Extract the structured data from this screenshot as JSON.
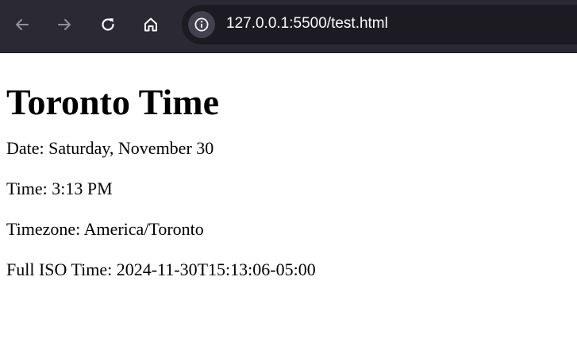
{
  "browser": {
    "url": "127.0.0.1:5500/test.html",
    "toolbar_color": "#2b2a33",
    "urlbar_color": "#1c1b22",
    "icons": {
      "back": "arrow-left-icon",
      "forward": "arrow-right-icon",
      "reload": "reload-icon",
      "home": "home-icon",
      "site_info": "info-circle-icon"
    }
  },
  "page": {
    "heading": "Toronto Time",
    "lines": {
      "date": "Date: Saturday, November 30",
      "time": "Time: 3:13 PM",
      "timezone": "Timezone: America/Toronto",
      "iso": "Full ISO Time: 2024-11-30T15:13:06-05:00"
    }
  }
}
